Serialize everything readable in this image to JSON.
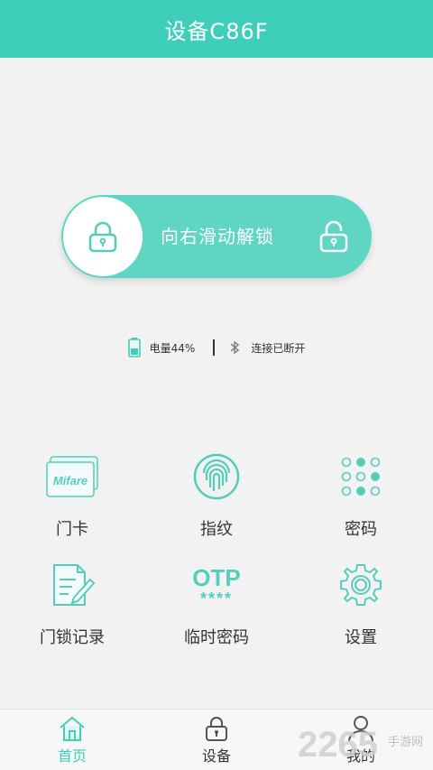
{
  "header": {
    "title": "设备C86F"
  },
  "slider": {
    "label": "向右滑动解锁"
  },
  "status": {
    "battery": "电量44%",
    "bluetooth": "连接已断开",
    "battery_level": 0.44
  },
  "features": [
    {
      "label": "门卡",
      "card_text": "Mifare"
    },
    {
      "label": "指纹"
    },
    {
      "label": "密码"
    },
    {
      "label": "门锁记录"
    },
    {
      "label": "临时密码",
      "otp_text": "OTP",
      "otp_stars": "****"
    },
    {
      "label": "设置"
    }
  ],
  "nav": [
    {
      "label": "首页"
    },
    {
      "label": "设备"
    },
    {
      "label": "我的"
    }
  ],
  "colors": {
    "accent": "#3ecfbb",
    "slider": "#5ed6c3",
    "icon": "#55cdbd"
  },
  "watermark": {
    "text": "2265",
    "sub": "手游网"
  }
}
